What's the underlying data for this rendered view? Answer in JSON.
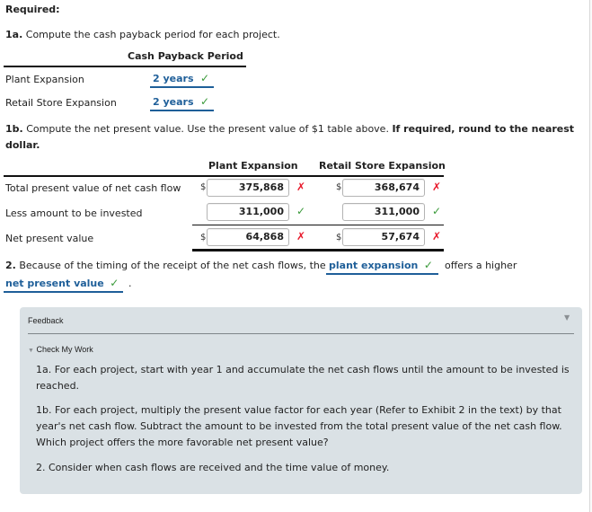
{
  "required_label": "Required:",
  "part_1a": {
    "number": "1a.",
    "instruction": "Compute the cash payback period for each project.",
    "column_header": "Cash Payback Period",
    "rows": [
      {
        "label": "Plant Expansion",
        "answer": "2 years",
        "status": "correct"
      },
      {
        "label": "Retail Store Expansion",
        "answer": "2 years",
        "status": "correct"
      }
    ]
  },
  "part_1b": {
    "number": "1b.",
    "instruction": "Compute the net present value. Use the present value of $1 table above.",
    "instruction_bold": "If required, round to the nearest dollar.",
    "columns": [
      "Plant Expansion",
      "Retail Store Expansion"
    ],
    "currency_symbol": "$",
    "rows": [
      {
        "label": "Total present value of net cash flow",
        "show_dollar": true,
        "values": [
          {
            "value": "375,868",
            "status": "incorrect"
          },
          {
            "value": "368,674",
            "status": "incorrect"
          }
        ]
      },
      {
        "label": "Less amount to be invested",
        "show_dollar": false,
        "values": [
          {
            "value": "311,000",
            "status": "correct"
          },
          {
            "value": "311,000",
            "status": "correct"
          }
        ]
      },
      {
        "label": "Net present value",
        "show_dollar": true,
        "values": [
          {
            "value": "64,868",
            "status": "incorrect"
          },
          {
            "value": "57,674",
            "status": "incorrect"
          }
        ]
      }
    ]
  },
  "part_2": {
    "number": "2.",
    "text_before": "Because of the timing of the receipt of the net cash flows, the",
    "answer_1": "plant expansion",
    "answer_1_status": "correct",
    "text_middle": "offers a higher",
    "answer_2": "net present value",
    "answer_2_status": "correct",
    "text_after": "."
  },
  "feedback": {
    "title": "Feedback",
    "toggle_icon": "triangle-down-icon",
    "section_title": "Check My Work",
    "hints": [
      "1a. For each project, start with year 1 and accumulate the net cash flows until the amount to be invested is reached.",
      "1b. For each project, multiply the present value factor for each year (Refer to Exhibit 2 in the text) by that year's net cash flow. Subtract the amount to be invested from the total present value of the net cash flow. Which project offers the more favorable net present value?",
      "2. Consider when cash flows are received and the time value of money."
    ]
  },
  "icons": {
    "check": "✓",
    "cross": "✗",
    "triangle_down": "▼"
  },
  "colors": {
    "answer_blue": "#1f5f99",
    "correct_green": "#3a9a3a",
    "incorrect_red": "#e8182a",
    "feedback_bg": "#dae1e5"
  }
}
